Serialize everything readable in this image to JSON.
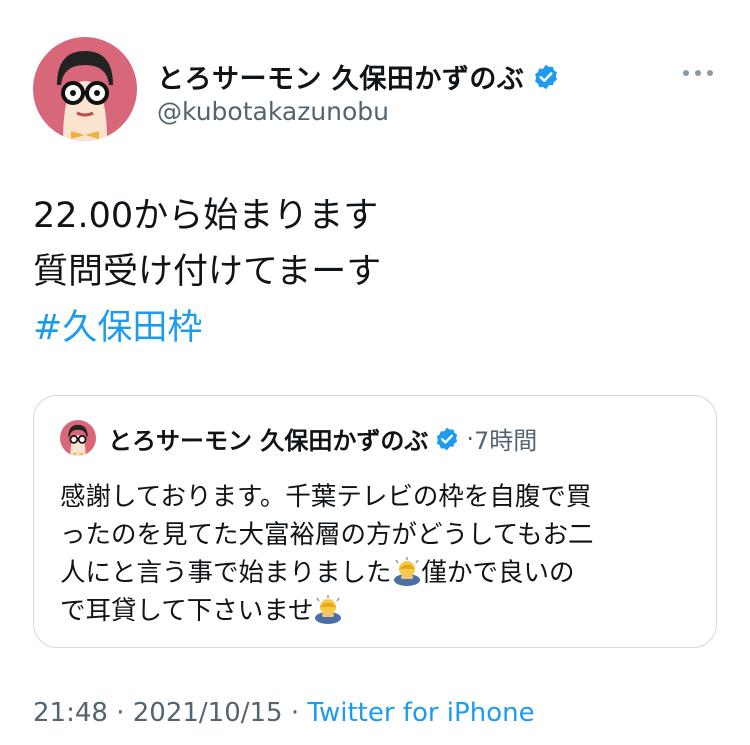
{
  "tweet": {
    "author_name": "とろサーモン 久保田かずのぶ",
    "author_handle": "@kubotakazunobu",
    "text_lines": [
      "22.00から始まります",
      "質問受け付けてまーす"
    ],
    "hashtag": "#久保田枠"
  },
  "quoted": {
    "author_name": "とろサーモン 久保田かずのぶ",
    "separator": "·",
    "time": "7時間",
    "body_lines": [
      "感謝しております。千葉テレビの枠を自腹で買",
      "ったのを見てた大富裕層の方がどうしてもお二",
      "人にと言う事で始まりました",
      "僅かで良いの",
      "で耳貸して下さいませ"
    ]
  },
  "footer": {
    "time": "21:48",
    "sep1": "·",
    "date": "2021/10/15",
    "sep2": "·",
    "source": "Twitter for iPhone"
  },
  "icons": {
    "verified": "verified-badge-icon",
    "more": "more-options-icon",
    "emoji": "person-bowing-emoji"
  },
  "colors": {
    "link": "#1d9bf0",
    "secondary_text": "#536471",
    "avatar_bg": "#d9677a"
  }
}
